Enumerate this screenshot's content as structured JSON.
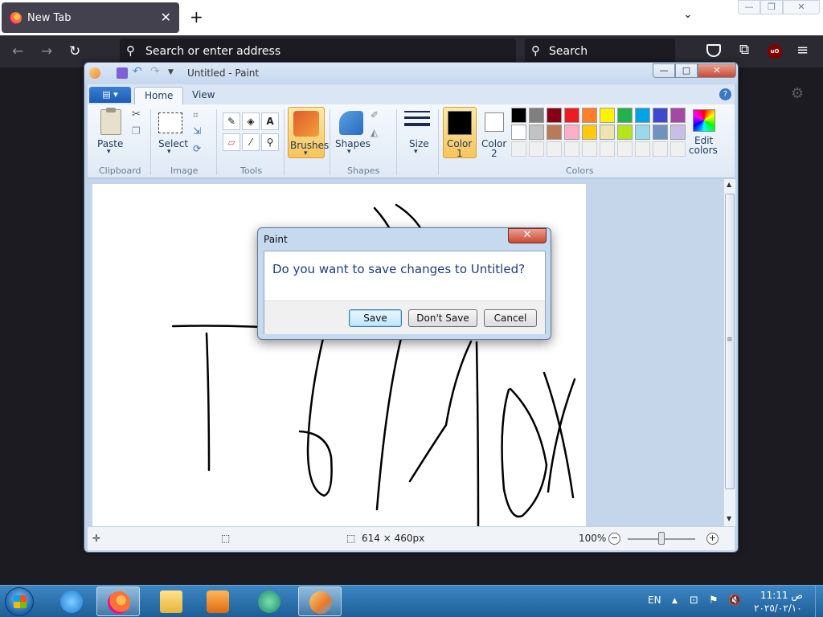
{
  "browser": {
    "tab_title": "New Tab",
    "tab_close": "✕",
    "new_tab": "+",
    "tab_list": "⌄",
    "window_controls": {
      "minimize": "—",
      "restore": "❐",
      "close": "✕"
    },
    "nav": {
      "back": "←",
      "forward": "→",
      "reload": "↻"
    },
    "url_placeholder": "Search or enter address",
    "search_placeholder": "Search",
    "ublock_label": "uO",
    "menu": "≡",
    "extensions": "⧉",
    "settings": "⚙"
  },
  "paint": {
    "title": "Untitled - Paint",
    "quick_access": {
      "undo": "↶",
      "redo": "↷",
      "dropdown": "▼"
    },
    "window_controls": {
      "minimize": "—",
      "maximize": "□",
      "close": "✕"
    },
    "file_menu": "▤ ▾",
    "tabs": [
      {
        "label": "Home"
      },
      {
        "label": "View"
      }
    ],
    "help": "?",
    "groups": {
      "clipboard": "Clipboard",
      "image": "Image",
      "tools": "Tools",
      "shapes": "Shapes",
      "colors": "Colors"
    },
    "buttons": {
      "paste": "Paste",
      "select": "Select",
      "brushes": "Brushes",
      "shapes": "Shapes",
      "size": "Size",
      "color1_line1": "Color",
      "color1_line2": "1",
      "color2_line1": "Color",
      "color2_line2": "2",
      "edit_colors_line1": "Edit",
      "edit_colors_line2": "colors",
      "dropdown": "▾"
    },
    "tool_glyphs": {
      "pencil": "✎",
      "fill": "◈",
      "text": "A",
      "eraser": "▱",
      "picker": "⁄",
      "magnifier": "⚲",
      "cut": "✂",
      "copy": "❐",
      "crop": "⌗",
      "resize": "⇲",
      "rotate": "⟳",
      "outline": "✐",
      "fill_shape": "◭"
    },
    "palette": [
      "#000000",
      "#7f7f7f",
      "#880015",
      "#ed1c24",
      "#ff7f27",
      "#fff200",
      "#22b14c",
      "#00a2e8",
      "#3f48cc",
      "#a349a4",
      "#ffffff",
      "#c3c3c3",
      "#b97a57",
      "#ffaec9",
      "#ffc90e",
      "#efe4b0",
      "#b5e61d",
      "#99d9ea",
      "#7092be",
      "#c8bfe7",
      "#f0f0f0",
      "#f0f0f0",
      "#f0f0f0",
      "#f0f0f0",
      "#f0f0f0",
      "#f0f0f0",
      "#f0f0f0",
      "#f0f0f0",
      "#f0f0f0",
      "#f0f0f0"
    ],
    "status": {
      "move_icon": "✛",
      "select_icon": "⬚",
      "size_icon": "⬚",
      "dimensions": "614 × 460px",
      "zoom": "100%",
      "zoom_minus": "−",
      "zoom_plus": "+",
      "zoom_level": 0.5
    },
    "scroll": {
      "up": "▲",
      "down": "▼",
      "grip": "≡"
    }
  },
  "dialog": {
    "title": "Paint",
    "close": "✕",
    "message": "Do you want to save changes to Untitled?",
    "save": "Save",
    "dont_save": "Don't Save",
    "cancel": "Cancel"
  },
  "taskbar": {
    "language": "EN",
    "tray": {
      "expand": "▲",
      "network": "⊡",
      "flag": "⚑",
      "volume": "🔇"
    },
    "clock_time": "11:11 ص",
    "clock_date": "٢٠٢٥/٠٢/١٠"
  }
}
